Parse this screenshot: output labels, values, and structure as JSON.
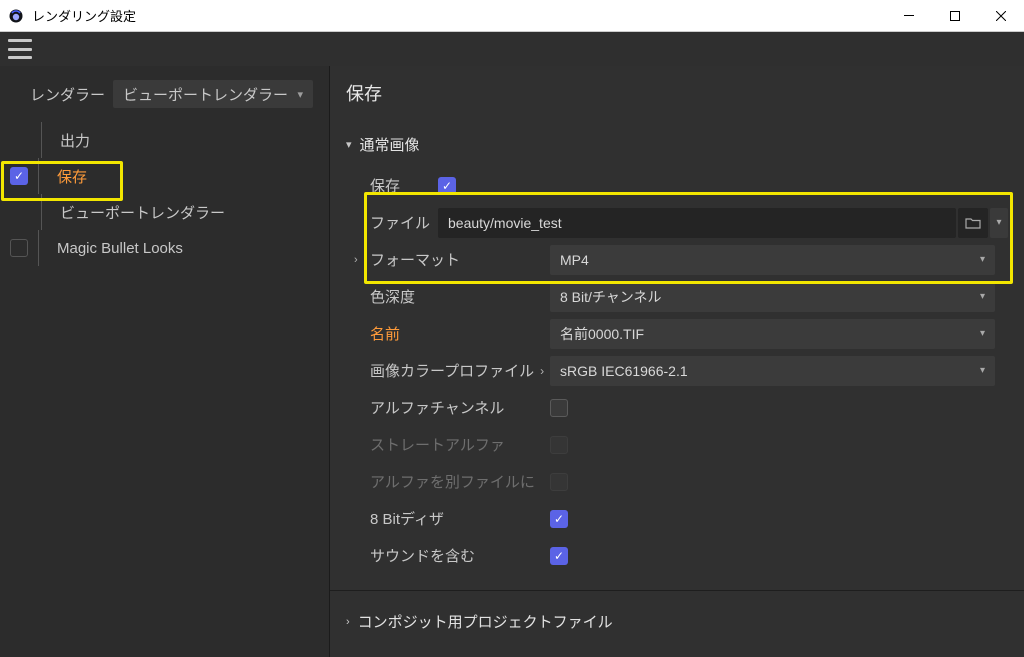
{
  "window": {
    "title": "レンダリング設定"
  },
  "sidebar": {
    "renderer_label": "レンダラー",
    "renderer_value": "ビューポートレンダラー",
    "items": [
      {
        "label": "出力",
        "checked": null
      },
      {
        "label": "保存",
        "checked": true,
        "selected": true
      },
      {
        "label": "ビューポートレンダラー",
        "checked": null
      },
      {
        "label": "Magic Bullet Looks",
        "checked": false
      }
    ]
  },
  "panel": {
    "title": "保存",
    "section1": {
      "header": "通常画像",
      "rows": {
        "save_label": "保存",
        "save_checked": true,
        "file_label": "ファイル",
        "file_value": "beauty/movie_test",
        "format_label": "フォーマット",
        "format_value": "MP4",
        "depth_label": "色深度",
        "depth_value": "8 Bit/チャンネル",
        "name_label": "名前",
        "name_value": "名前0000.TIF",
        "profile_label": "画像カラープロファイル",
        "profile_value": "sRGB IEC61966-2.1",
        "alpha_label": "アルファチャンネル",
        "alpha_checked": false,
        "straight_label": "ストレートアルファ",
        "straight_checked": false,
        "alpha_sep_label": "アルファを別ファイルに",
        "alpha_sep_checked": false,
        "dither_label": "8 Bitディザ",
        "dither_checked": true,
        "sound_label": "サウンドを含む",
        "sound_checked": true
      }
    },
    "section2": {
      "header": "コンポジット用プロジェクトファイル"
    }
  }
}
